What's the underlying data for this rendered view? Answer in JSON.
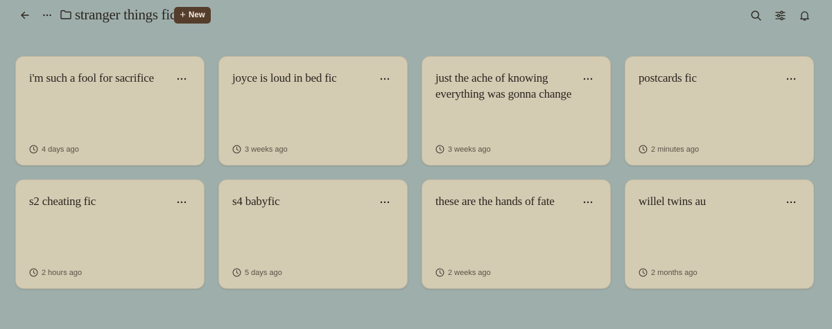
{
  "header": {
    "back_icon": "arrow-left-icon",
    "more_icon": "more-horizontal-icon",
    "folder_icon": "folder-icon",
    "folder_title": "stranger things fic",
    "new_button_label": "New",
    "new_button_icon": "plus-icon",
    "right_icons": [
      "search-icon",
      "sliders-icon",
      "bell-icon"
    ]
  },
  "colors": {
    "background": "#9eaeab",
    "card": "#d4cbb3",
    "new_button": "#553d2c"
  },
  "cards": [
    {
      "title": "i'm such a fool for sacrifice",
      "time": "4 days ago"
    },
    {
      "title": "joyce is loud in bed fic",
      "time": "3 weeks ago"
    },
    {
      "title": "just the ache of knowing everything was gonna change",
      "time": "3 weeks ago"
    },
    {
      "title": "postcards fic",
      "time": "2 minutes ago"
    },
    {
      "title": "s2 cheating fic",
      "time": "2 hours ago"
    },
    {
      "title": "s4 babyfic",
      "time": "5 days ago"
    },
    {
      "title": "these are the hands of fate",
      "time": "2 weeks ago"
    },
    {
      "title": "willel twins au",
      "time": "2 months ago"
    }
  ]
}
